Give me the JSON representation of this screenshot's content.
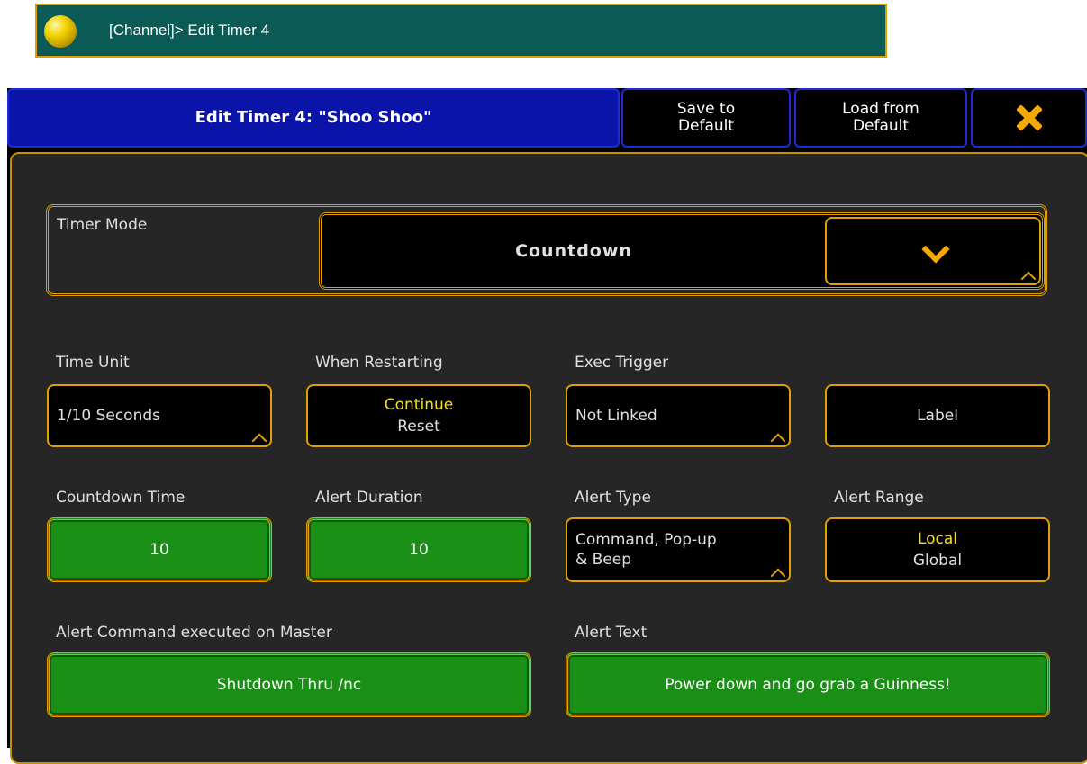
{
  "command_line": {
    "text": "[Channel]> Edit Timer 4"
  },
  "title_bar": {
    "title": "Edit Timer 4: \"Shoo Shoo\"",
    "save_label_1": "Save to",
    "save_label_2": "Default",
    "load_label_1": "Load from",
    "load_label_2": "Default",
    "close_icon": "close-x-icon"
  },
  "timer_mode": {
    "label": "Timer Mode",
    "value": "Countdown",
    "dropdown_icon": "chevron-down-icon"
  },
  "time_unit": {
    "label": "Time Unit",
    "value": "1/10 Seconds"
  },
  "when_restarting": {
    "label": "When Restarting",
    "selected": "Continue",
    "other": "Reset"
  },
  "exec_trigger": {
    "label": "Exec Trigger",
    "value": "Not Linked"
  },
  "label_button": {
    "label": "Label"
  },
  "countdown_time": {
    "label": "Countdown Time",
    "value": "10"
  },
  "alert_duration": {
    "label": "Alert Duration",
    "value": "10"
  },
  "alert_type": {
    "label": "Alert Type",
    "value_line1": "Command, Pop-up",
    "value_line2": "& Beep"
  },
  "alert_range": {
    "label": "Alert Range",
    "selected": "Local",
    "other": "Global"
  },
  "alert_command": {
    "label": "Alert Command executed on Master",
    "value": "Shutdown Thru /nc"
  },
  "alert_text": {
    "label": "Alert Text",
    "value": "Power down and go grab a Guinness!"
  },
  "colors": {
    "command_line_bg": "#0a5a55",
    "title_bg": "#0a14a8",
    "accent_border": "#e0a000",
    "green_field": "#1a8f16",
    "selected_text": "#f0e020"
  }
}
